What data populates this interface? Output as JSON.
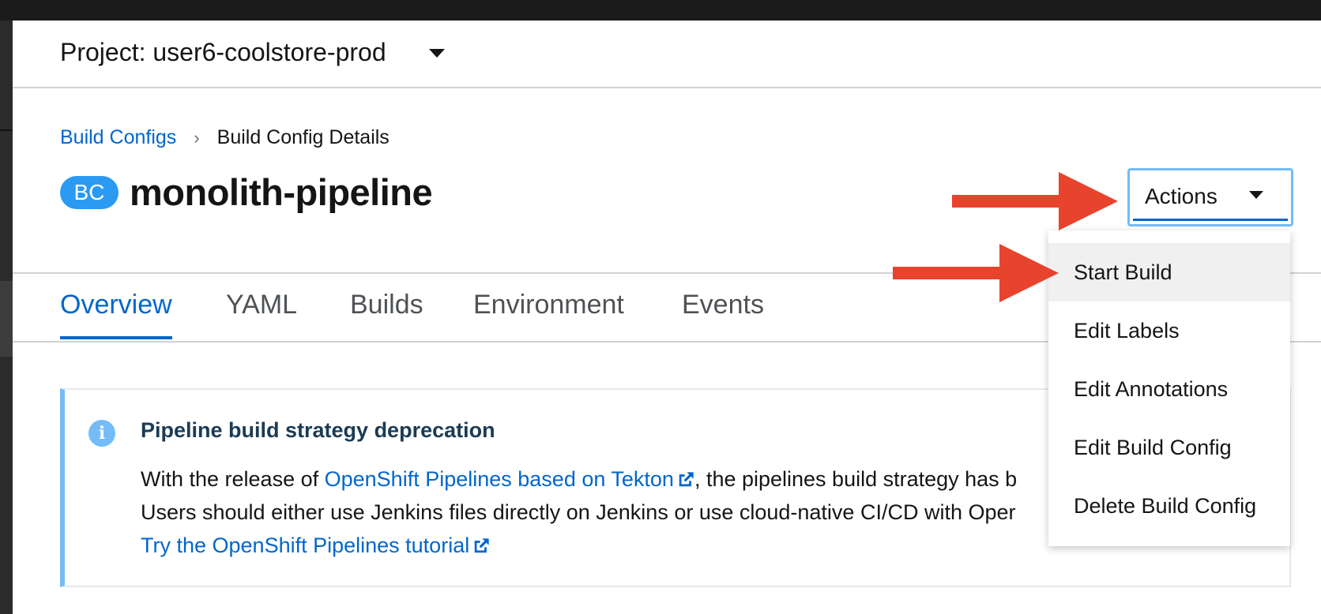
{
  "project": {
    "label": "Project: user6-coolstore-prod"
  },
  "breadcrumb": {
    "parent": "Build Configs",
    "separator": "›",
    "current": "Build Config Details"
  },
  "resource": {
    "badge": "BC",
    "name": "monolith-pipeline"
  },
  "actions": {
    "label": "Actions"
  },
  "tabs": [
    {
      "label": "Overview",
      "active": true
    },
    {
      "label": "YAML",
      "active": false
    },
    {
      "label": "Builds",
      "active": false
    },
    {
      "label": "Environment",
      "active": false
    },
    {
      "label": "Events",
      "active": false
    }
  ],
  "alert": {
    "title": "Pipeline build strategy deprecation",
    "line1_prefix": "With the release of ",
    "line1_link": "OpenShift Pipelines based on Tekton",
    "line1_suffix": ", the pipelines build strategy has b",
    "line2": "Users should either use Jenkins files directly on Jenkins or use cloud-native CI/CD with Oper",
    "line3_link": "Try the OpenShift Pipelines tutorial"
  },
  "menu": {
    "items": [
      {
        "label": "Start Build",
        "highlighted": true
      },
      {
        "label": "Edit Labels",
        "highlighted": false
      },
      {
        "label": "Edit Annotations",
        "highlighted": false
      },
      {
        "label": "Edit Build Config",
        "highlighted": false
      },
      {
        "label": "Delete Build Config",
        "highlighted": false
      }
    ]
  },
  "colors": {
    "link": "#0066cc",
    "badge": "#2b9af3",
    "alert_accent": "#73bcf7",
    "annotation_arrow": "#e8432c"
  },
  "icons": [
    "caret-down-icon",
    "angle-right-icon",
    "info-circle-icon",
    "external-link-icon"
  ]
}
